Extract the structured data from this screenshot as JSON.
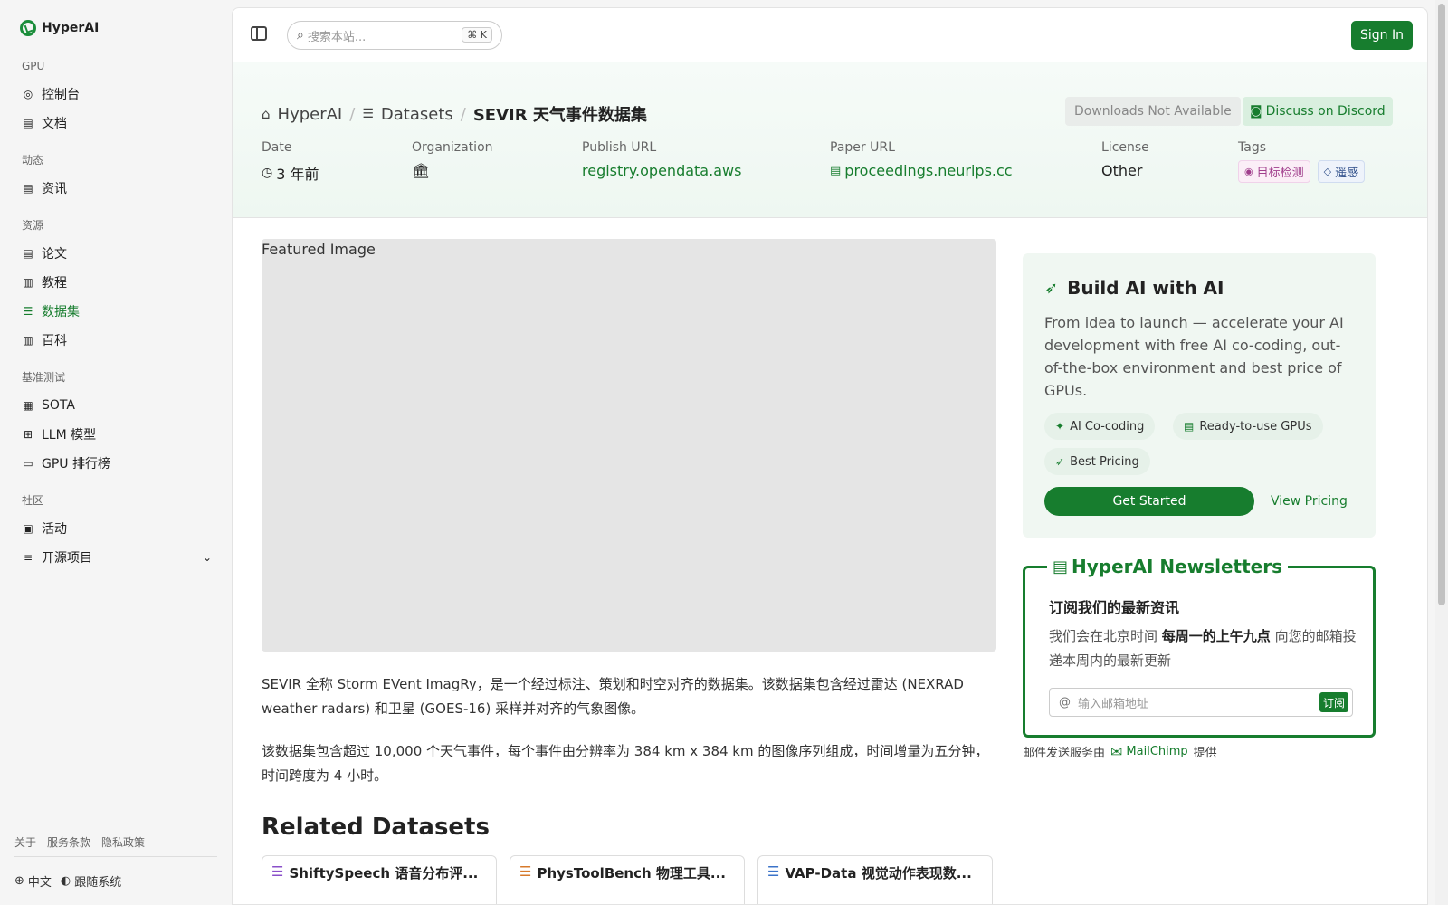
{
  "app": {
    "brand": "HyperAI"
  },
  "sidebar": {
    "sections": [
      {
        "title": "GPU",
        "items": [
          {
            "label": "控制台",
            "icon": "gauge-icon"
          },
          {
            "label": "文档",
            "icon": "doc-icon"
          }
        ]
      },
      {
        "title": "动态",
        "items": [
          {
            "label": "资讯",
            "icon": "news-icon"
          }
        ]
      },
      {
        "title": "资源",
        "items": [
          {
            "label": "论文",
            "icon": "paper-icon"
          },
          {
            "label": "教程",
            "icon": "book-icon"
          },
          {
            "label": "数据集",
            "icon": "database-icon",
            "active": true
          },
          {
            "label": "百科",
            "icon": "wiki-icon"
          }
        ]
      },
      {
        "title": "基准测试",
        "items": [
          {
            "label": "SOTA",
            "icon": "chart-icon"
          },
          {
            "label": "LLM 模型",
            "icon": "chip-icon"
          },
          {
            "label": "GPU 排行榜",
            "icon": "monitor-icon"
          }
        ]
      },
      {
        "title": "社区",
        "items": [
          {
            "label": "活动",
            "icon": "calendar-icon"
          },
          {
            "label": "开源项目",
            "icon": "list-icon"
          }
        ]
      }
    ],
    "footer_links": [
      "关于",
      "服务条款",
      "隐私政策"
    ],
    "language": "中文",
    "tracking": "跟随系统"
  },
  "header": {
    "search_placeholder": "搜索本站...",
    "shortcut_key": "K",
    "sign_in": "Sign In"
  },
  "hero": {
    "breadcrumb": [
      "HyperAI",
      "Datasets",
      "SEVIR 天气事件数据集"
    ],
    "downloads_label": "Downloads Not Available",
    "discord_label": "Discuss on Discord",
    "meta": {
      "date_label": "Date",
      "date_value": "3 年前",
      "org_label": "Organization",
      "publish_label": "Publish URL",
      "publish_value": "registry.opendata.aws",
      "paper_label": "Paper URL",
      "paper_value": "proceedings.neurips.cc",
      "license_label": "License",
      "license_value": "Other",
      "tags_label": "Tags",
      "tags": [
        "目标检测",
        "遥感"
      ]
    }
  },
  "content": {
    "featured_alt": "Featured Image",
    "para1": "SEVIR 全称 Storm EVent ImagRy，是一个经过标注、策划和时空对齐的数据集。该数据集包含经过雷达 (NEXRAD weather radars) 和卫星 (GOES-16) 采样并对齐的气象图像。",
    "para2": "该数据集包含超过 10,000 个天气事件，每个事件由分辨率为 384 km x 384 km 的图像序列组成，时间增量为五分钟，时间跨度为 4 小时。",
    "related_title": "Related Datasets",
    "related": [
      "ShiftySpeech 语音分布评...",
      "PhysToolBench 物理工具...",
      "VAP-Data 视觉动作表现数..."
    ]
  },
  "promo": {
    "title": "Build AI with AI",
    "text": "From idea to launch — accelerate your AI development with free AI co-coding, out-of-the-box environment and best price of GPUs.",
    "pills": [
      "AI Co-coding",
      "Ready-to-use GPUs",
      "Best Pricing"
    ],
    "cta": "Get Started",
    "secondary": "View Pricing"
  },
  "newsletter": {
    "title": "HyperAI Newsletters",
    "subtitle": "订阅我们的最新资讯",
    "body_prefix": "我们会在北京时间",
    "body_bold": "每周一的上午九点",
    "body_suffix": "向您的邮箱投递本周内的最新更新",
    "email_placeholder": "输入邮箱地址",
    "subscribe": "订阅",
    "provider_prefix": "邮件发送服务由",
    "provider_name": "MailChimp",
    "provider_suffix": "提供"
  },
  "colors": {
    "accent": "#177d2e"
  }
}
